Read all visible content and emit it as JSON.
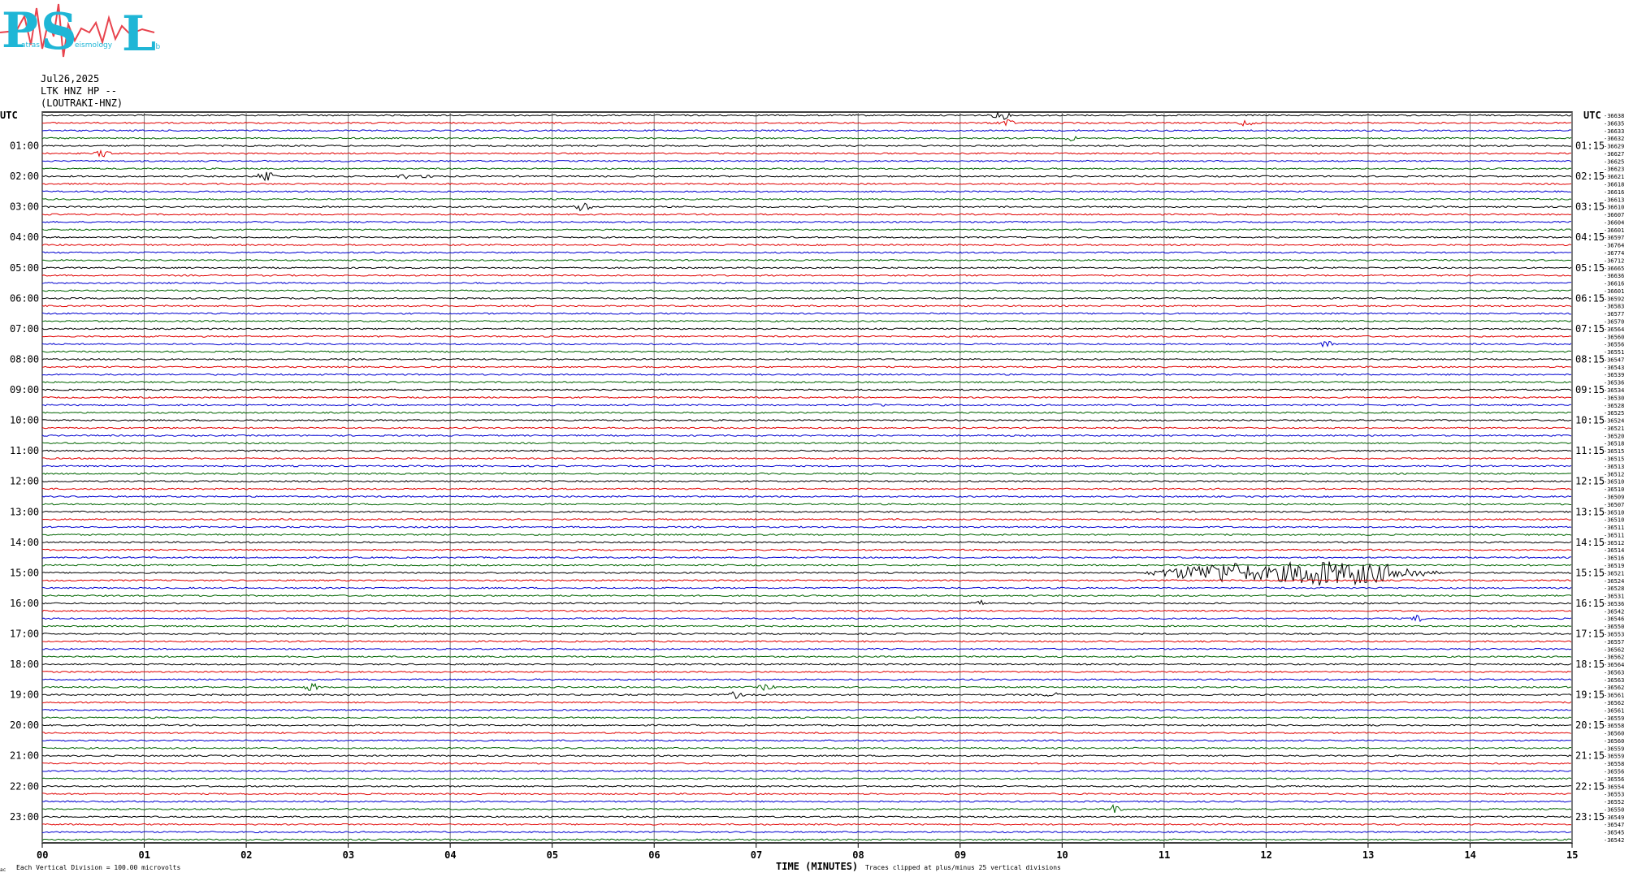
{
  "logo": {
    "letters": [
      "P",
      "S",
      "L"
    ],
    "small_words": [
      "atras",
      "eismology",
      "ab"
    ],
    "letter_color": "#1fb6d6",
    "wave_color": "#e8434d"
  },
  "header": {
    "date": "Jul26,2025",
    "station": "LTK HNZ HP --",
    "channel": "(LOUTRAKI-HNZ)"
  },
  "footer": {
    "scale_note": "Each Vertical Division =  100.00 microvolts",
    "x_axis_title": "TIME (MINUTES)",
    "clip_note": "Traces clipped at plus/minus 25 vertical divisions",
    "corner_mark": "ac"
  },
  "chart_data": {
    "type": "line",
    "title": "LTK HNZ HP --",
    "xlabel": "TIME (MINUTES)",
    "ylabel": "UTC",
    "xlim": [
      0,
      15
    ],
    "x_ticks": [
      "00",
      "01",
      "02",
      "03",
      "04",
      "05",
      "06",
      "07",
      "08",
      "09",
      "10",
      "11",
      "12",
      "13",
      "14",
      "15"
    ],
    "left_axis_label": "UTC",
    "right_axis_label": "UTC",
    "left_hour_labels": [
      "01:00",
      "02:00",
      "03:00",
      "04:00",
      "05:00",
      "06:00",
      "07:00",
      "08:00",
      "09:00",
      "10:00",
      "11:00",
      "12:00",
      "13:00",
      "14:00",
      "15:00",
      "16:00",
      "17:00",
      "18:00",
      "19:00",
      "20:00",
      "21:00",
      "22:00",
      "23:00"
    ],
    "right_hour_labels": [
      "01:15",
      "02:15",
      "03:15",
      "04:15",
      "05:15",
      "06:15",
      "07:15",
      "08:15",
      "09:15",
      "10:15",
      "11:15",
      "12:15",
      "13:15",
      "14:15",
      "15:15",
      "16:15",
      "17:15",
      "18:15",
      "19:15",
      "20:15",
      "21:15",
      "22:15",
      "23:15"
    ],
    "trace_colors": [
      "#000000",
      "#e00000",
      "#0000d0",
      "#006400"
    ],
    "trace_minutes": 15,
    "trace_count": 96,
    "trace_offsets": [
      "36638",
      "36635",
      "36633",
      "36632",
      "36629",
      "36627",
      "36625",
      "36623",
      "36621",
      "36618",
      "36616",
      "36613",
      "36610",
      "36607",
      "36604",
      "36601",
      "36597",
      "36764",
      "36774",
      "36712",
      "36665",
      "36636",
      "36616",
      "36601",
      "36592",
      "36583",
      "36577",
      "36570",
      "36564",
      "36560",
      "36556",
      "36551",
      "36547",
      "36543",
      "36539",
      "36536",
      "36534",
      "36530",
      "36528",
      "36525",
      "36524",
      "36521",
      "36520",
      "36518",
      "36515",
      "36515",
      "36513",
      "36512",
      "36510",
      "36510",
      "36509",
      "36507",
      "36510",
      "36510",
      "36511",
      "36511",
      "36512",
      "36514",
      "36516",
      "36519",
      "36521",
      "36524",
      "36528",
      "36531",
      "36536",
      "36542",
      "36546",
      "36550",
      "36553",
      "36557",
      "36562",
      "36562",
      "36564",
      "36563",
      "36563",
      "36562",
      "36561",
      "36562",
      "36561",
      "36559",
      "36558",
      "36560",
      "36560",
      "36559",
      "36559",
      "36558",
      "36556",
      "36556",
      "36554",
      "36553",
      "36552",
      "36550",
      "36549",
      "36547",
      "36545",
      "36542"
    ],
    "events": [
      {
        "trace": 0,
        "minute": 9.4,
        "amplitude": 7
      },
      {
        "trace": 1,
        "minute": 9.45,
        "amplitude": 6
      },
      {
        "trace": 1,
        "minute": 11.8,
        "amplitude": 5
      },
      {
        "trace": 3,
        "minute": 10.1,
        "amplitude": 4
      },
      {
        "trace": 5,
        "minute": 0.6,
        "amplitude": 6
      },
      {
        "trace": 8,
        "minute": 2.2,
        "amplitude": 9
      },
      {
        "trace": 8,
        "minute": 3.55,
        "amplitude": 4
      },
      {
        "trace": 8,
        "minute": 3.8,
        "amplitude": 4
      },
      {
        "trace": 12,
        "minute": 5.3,
        "amplitude": 7
      },
      {
        "trace": 30,
        "minute": 12.6,
        "amplitude": 5
      },
      {
        "trace": 38,
        "minute": 8.2,
        "amplitude": 3
      },
      {
        "trace": 60,
        "minute": 11.6,
        "amplitude": 14
      },
      {
        "trace": 60,
        "minute": 12.5,
        "amplitude": 18
      },
      {
        "trace": 60,
        "minute": 12.9,
        "amplitude": 15
      },
      {
        "trace": 64,
        "minute": 9.2,
        "amplitude": 4
      },
      {
        "trace": 66,
        "minute": 13.5,
        "amplitude": 5
      },
      {
        "trace": 75,
        "minute": 2.65,
        "amplitude": 6
      },
      {
        "trace": 76,
        "minute": 6.8,
        "amplitude": 5
      },
      {
        "trace": 75,
        "minute": 7.1,
        "amplitude": 5
      },
      {
        "trace": 76,
        "minute": 9.9,
        "amplitude": 4
      },
      {
        "trace": 91,
        "minute": 10.5,
        "amplitude": 6
      }
    ],
    "grid": true
  }
}
